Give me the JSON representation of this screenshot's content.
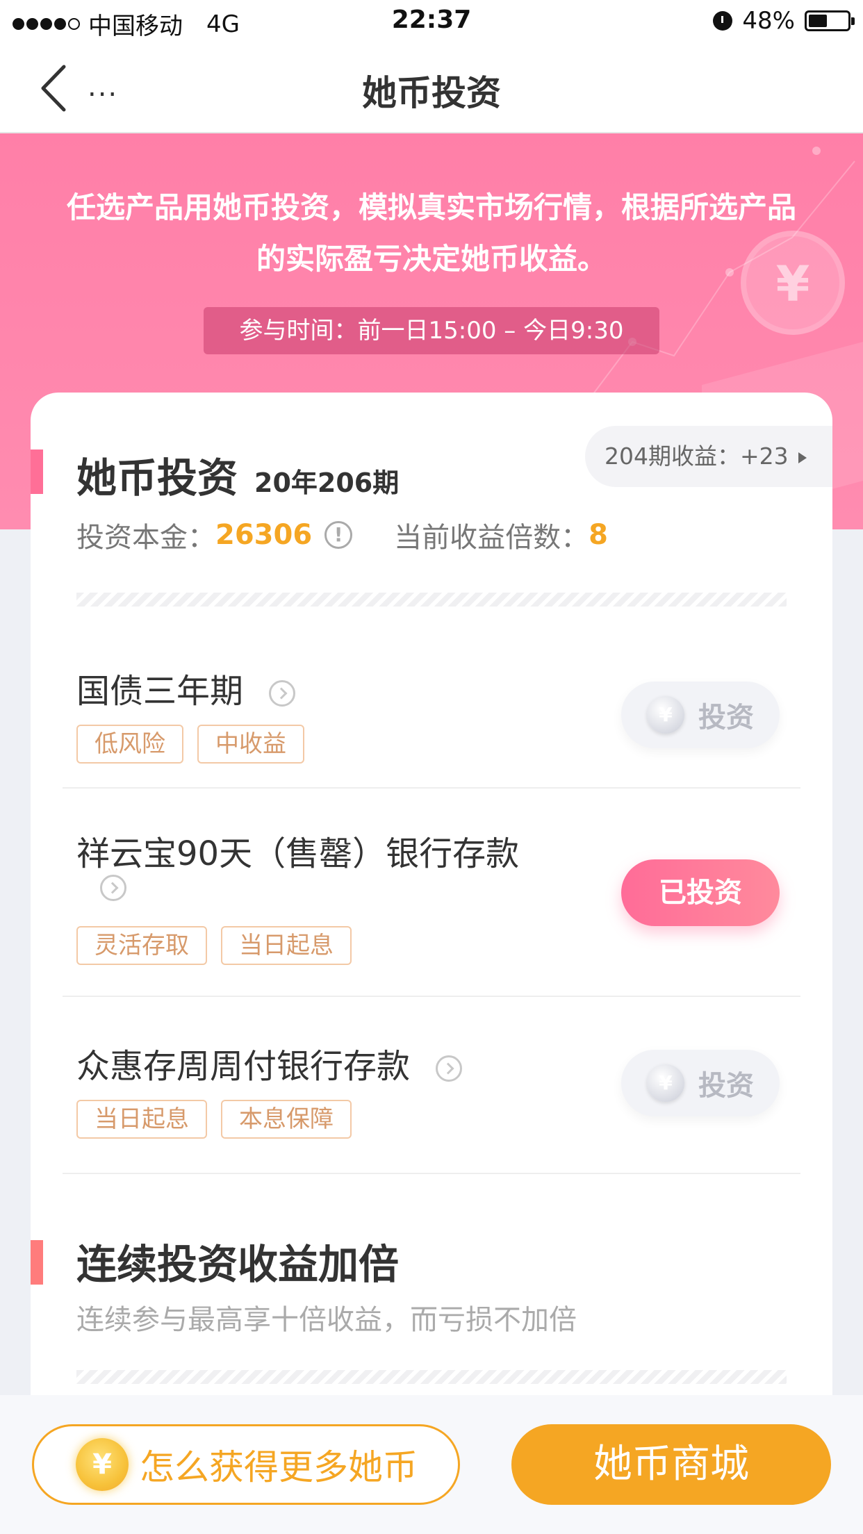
{
  "status_bar": {
    "carrier": "中国移动",
    "network": "4G",
    "time": "22:37",
    "battery": "48%",
    "battery_level": 0.48
  },
  "nav": {
    "title": "她币投资",
    "more": "..."
  },
  "hero": {
    "intro": "任选产品用她币投资，模拟真实市场行情，根据所选产品的实际盈亏决定她币收益。",
    "time_range": "参与时间：前一日15:00 – 今日9:30",
    "deco_symbol": "¥"
  },
  "section": {
    "title": "她币投资",
    "issue": "20年206期",
    "prev_earnings": "204期收益：+23",
    "principal_label": "投资本金：",
    "principal_value": "26306",
    "info_symbol": "!",
    "multiplier_label": "当前收益倍数：",
    "multiplier_value": "8"
  },
  "products": [
    {
      "name": "国债三年期",
      "tags": [
        "低风险",
        "中收益"
      ],
      "action": "投资",
      "coin": "¥"
    },
    {
      "name": "祥云宝90天（售罄）银行存款",
      "tags": [
        "灵活存取",
        "当日起息"
      ],
      "action": "已投资"
    },
    {
      "name": "众惠存周周付银行存款",
      "tags": [
        "当日起息",
        "本息保障"
      ],
      "action": "投资",
      "coin": "¥"
    }
  ],
  "section2": {
    "title": "连续投资收益加倍",
    "subtitle": "连续参与最高享十倍收益，而亏损不加倍"
  },
  "bottom": {
    "earn_label": "怎么获得更多她币",
    "earn_coin": "¥",
    "mall_label": "她币商城"
  },
  "colors": {
    "pink": "#ff7fa8",
    "orange": "#f5a623",
    "tag_text": "#d79a6b"
  }
}
